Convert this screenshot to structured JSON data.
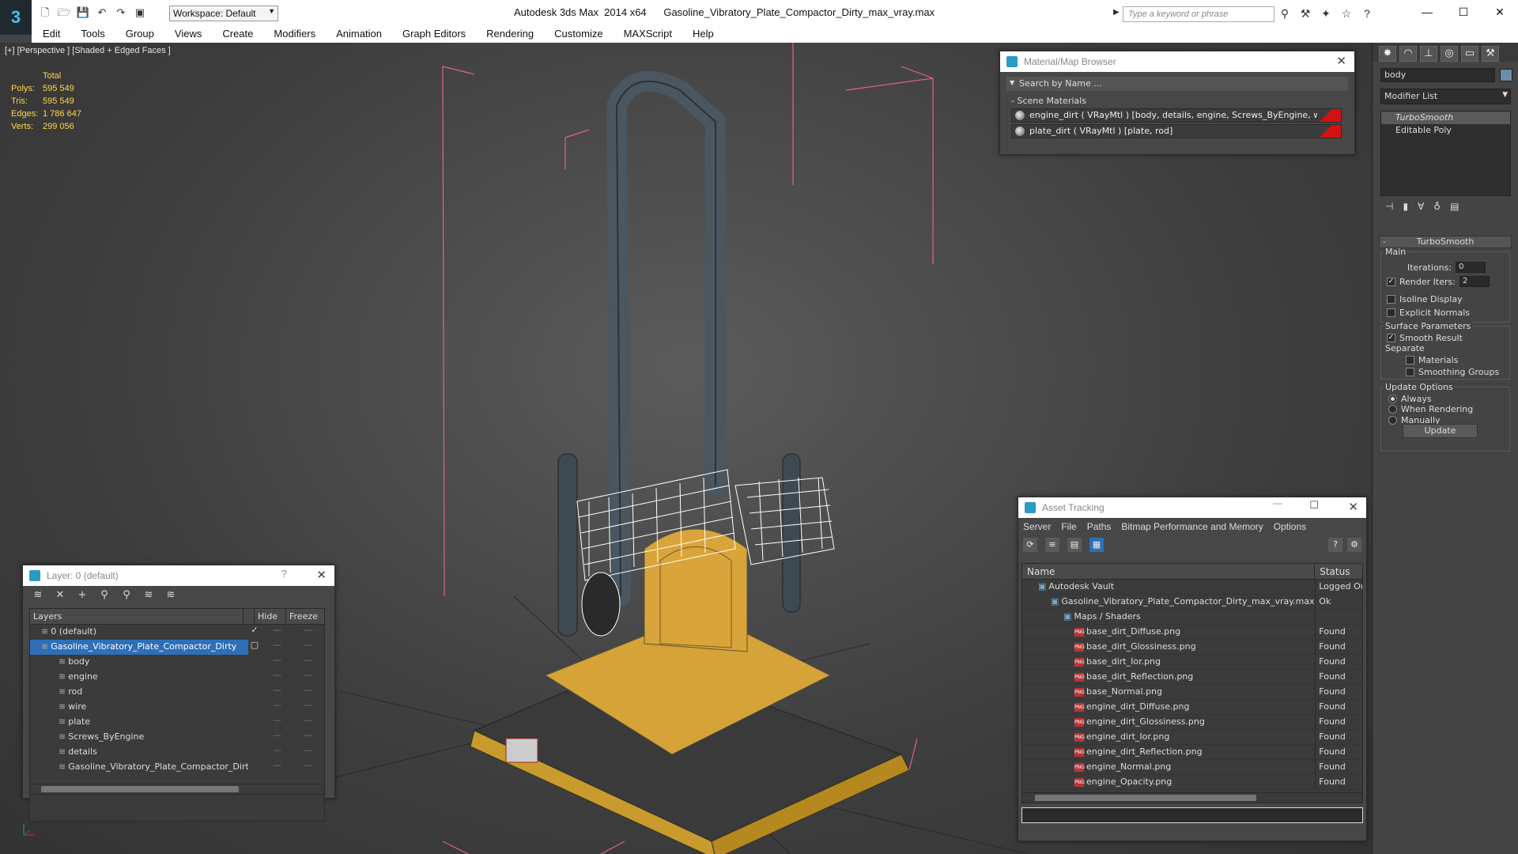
{
  "app": {
    "title": "Autodesk 3ds Max  2014 x64      Gasoline_Vibratory_Plate_Compactor_Dirty_max_vray.max",
    "workspace": "Workspace: Default",
    "search_placeholder": "Type a keyword or phrase",
    "accent": "#49c0e8"
  },
  "menu": [
    "Edit",
    "Tools",
    "Group",
    "Views",
    "Create",
    "Modifiers",
    "Animation",
    "Graph Editors",
    "Rendering",
    "Customize",
    "MAXScript",
    "Help"
  ],
  "viewport": {
    "label": "[+] [Perspective ] [Shaded + Edged Faces ]",
    "stats_title": "Total",
    "stats": [
      {
        "k": "Polys:",
        "v": "595 549"
      },
      {
        "k": "Tris:",
        "v": "595 549"
      },
      {
        "k": "Edges:",
        "v": "1 786 647"
      },
      {
        "k": "Verts:",
        "v": "299 056"
      }
    ]
  },
  "command_panel": {
    "object_name": "body",
    "modifier_list": "Modifier List",
    "stack": [
      "TurboSmooth",
      "Editable Poly"
    ],
    "rollout_title": "TurboSmooth",
    "main_label": "Main",
    "iterations_label": "Iterations:",
    "iterations_value": "0",
    "render_iters_label": "Render Iters:",
    "render_iters_value": "2",
    "isoline": "Isoline Display",
    "explicit_normals": "Explicit Normals",
    "surface_params": "Surface Parameters",
    "smooth_result": "Smooth Result",
    "separate": "Separate",
    "materials": "Materials",
    "smoothing_groups": "Smoothing Groups",
    "update_options": "Update Options",
    "always": "Always",
    "when_rendering": "When Rendering",
    "manually": "Manually",
    "update_button": "Update"
  },
  "material_browser": {
    "title": "Material/Map Browser",
    "search": "Search by Name ...",
    "section": "Scene Materials",
    "materials": [
      "engine_dirt  ( VRayMtl ) [body, details, engine, Screws_ByEngine, wire]",
      "plate_dirt  ( VRayMtl ) [plate, rod]"
    ]
  },
  "layers": {
    "title": "Layer: 0 (default)",
    "help": "?",
    "col_layers": "Layers",
    "col_hide": "Hide",
    "col_freeze": "Freeze",
    "rows": [
      {
        "name": "0 (default)",
        "indent": 14,
        "check": "✓"
      },
      {
        "name": "Gasoline_Vibratory_Plate_Compactor_Dirty",
        "indent": 14,
        "sel": true
      },
      {
        "name": "body",
        "indent": 36
      },
      {
        "name": "engine",
        "indent": 36
      },
      {
        "name": "rod",
        "indent": 36
      },
      {
        "name": "wire",
        "indent": 36
      },
      {
        "name": "plate",
        "indent": 36
      },
      {
        "name": "Screws_ByEngine",
        "indent": 36
      },
      {
        "name": "details",
        "indent": 36
      },
      {
        "name": "Gasoline_Vibratory_Plate_Compactor_Dirty",
        "indent": 36
      }
    ]
  },
  "asset_tracking": {
    "title": "Asset Tracking",
    "menu": [
      "Server",
      "File",
      "Paths",
      "Bitmap Performance and Memory",
      "Options"
    ],
    "col_name": "Name",
    "col_status": "Status",
    "rows": [
      {
        "name": "Autodesk Vault",
        "indent": 20,
        "status": "Logged Ou"
      },
      {
        "name": "Gasoline_Vibratory_Plate_Compactor_Dirty_max_vray.max",
        "indent": 36,
        "status": "Ok"
      },
      {
        "name": "Maps / Shaders",
        "indent": 52,
        "status": ""
      },
      {
        "name": "base_dirt_Diffuse.png",
        "indent": 66,
        "status": "Found",
        "png": true
      },
      {
        "name": "base_dirt_Glossiness.png",
        "indent": 66,
        "status": "Found",
        "png": true
      },
      {
        "name": "base_dirt_Ior.png",
        "indent": 66,
        "status": "Found",
        "png": true
      },
      {
        "name": "base_dirt_Reflection.png",
        "indent": 66,
        "status": "Found",
        "png": true
      },
      {
        "name": "base_Normal.png",
        "indent": 66,
        "status": "Found",
        "png": true
      },
      {
        "name": "engine_dirt_Diffuse.png",
        "indent": 66,
        "status": "Found",
        "png": true
      },
      {
        "name": "engine_dirt_Glossiness.png",
        "indent": 66,
        "status": "Found",
        "png": true
      },
      {
        "name": "engine_dirt_Ior.png",
        "indent": 66,
        "status": "Found",
        "png": true
      },
      {
        "name": "engine_dirt_Reflection.png",
        "indent": 66,
        "status": "Found",
        "png": true
      },
      {
        "name": "engine_Normal.png",
        "indent": 66,
        "status": "Found",
        "png": true
      },
      {
        "name": "engine_Opacity.png",
        "indent": 66,
        "status": "Found",
        "png": true
      }
    ]
  }
}
